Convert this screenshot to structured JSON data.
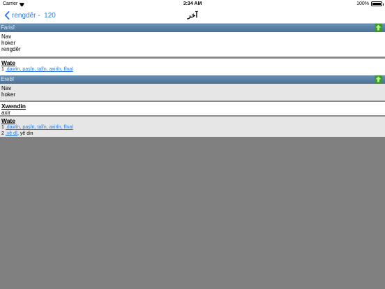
{
  "status_bar": {
    "carrier": "Carrier",
    "time": "3:34 AM",
    "battery": "100%",
    "battery_level": 1.0
  },
  "nav": {
    "back_label": "rengdêr -  120",
    "title": "آخر"
  },
  "sections": {
    "farisi": {
      "header": "Farisî",
      "words": [
        "Nav",
        "hoker",
        "rengdêr"
      ],
      "wate_title": "Wate",
      "def1_num": "1 ",
      "def1_link": ".dawîn, paşîn, talîn, axirîn, fînal"
    },
    "erebi": {
      "header": "Erebî",
      "words": [
        "Nav",
        "hoker"
      ],
      "xwendin_title": "Xwendin",
      "xwendin_value": "axir",
      "wate_title": "Wate",
      "def1_num": "1 ",
      "def1_link": ".dawîn, paşîn, talîn, axirîn, fînal",
      "def2_num": "2 ",
      "def2_link": ".yê dî",
      "def2_text": ", yê din"
    }
  }
}
